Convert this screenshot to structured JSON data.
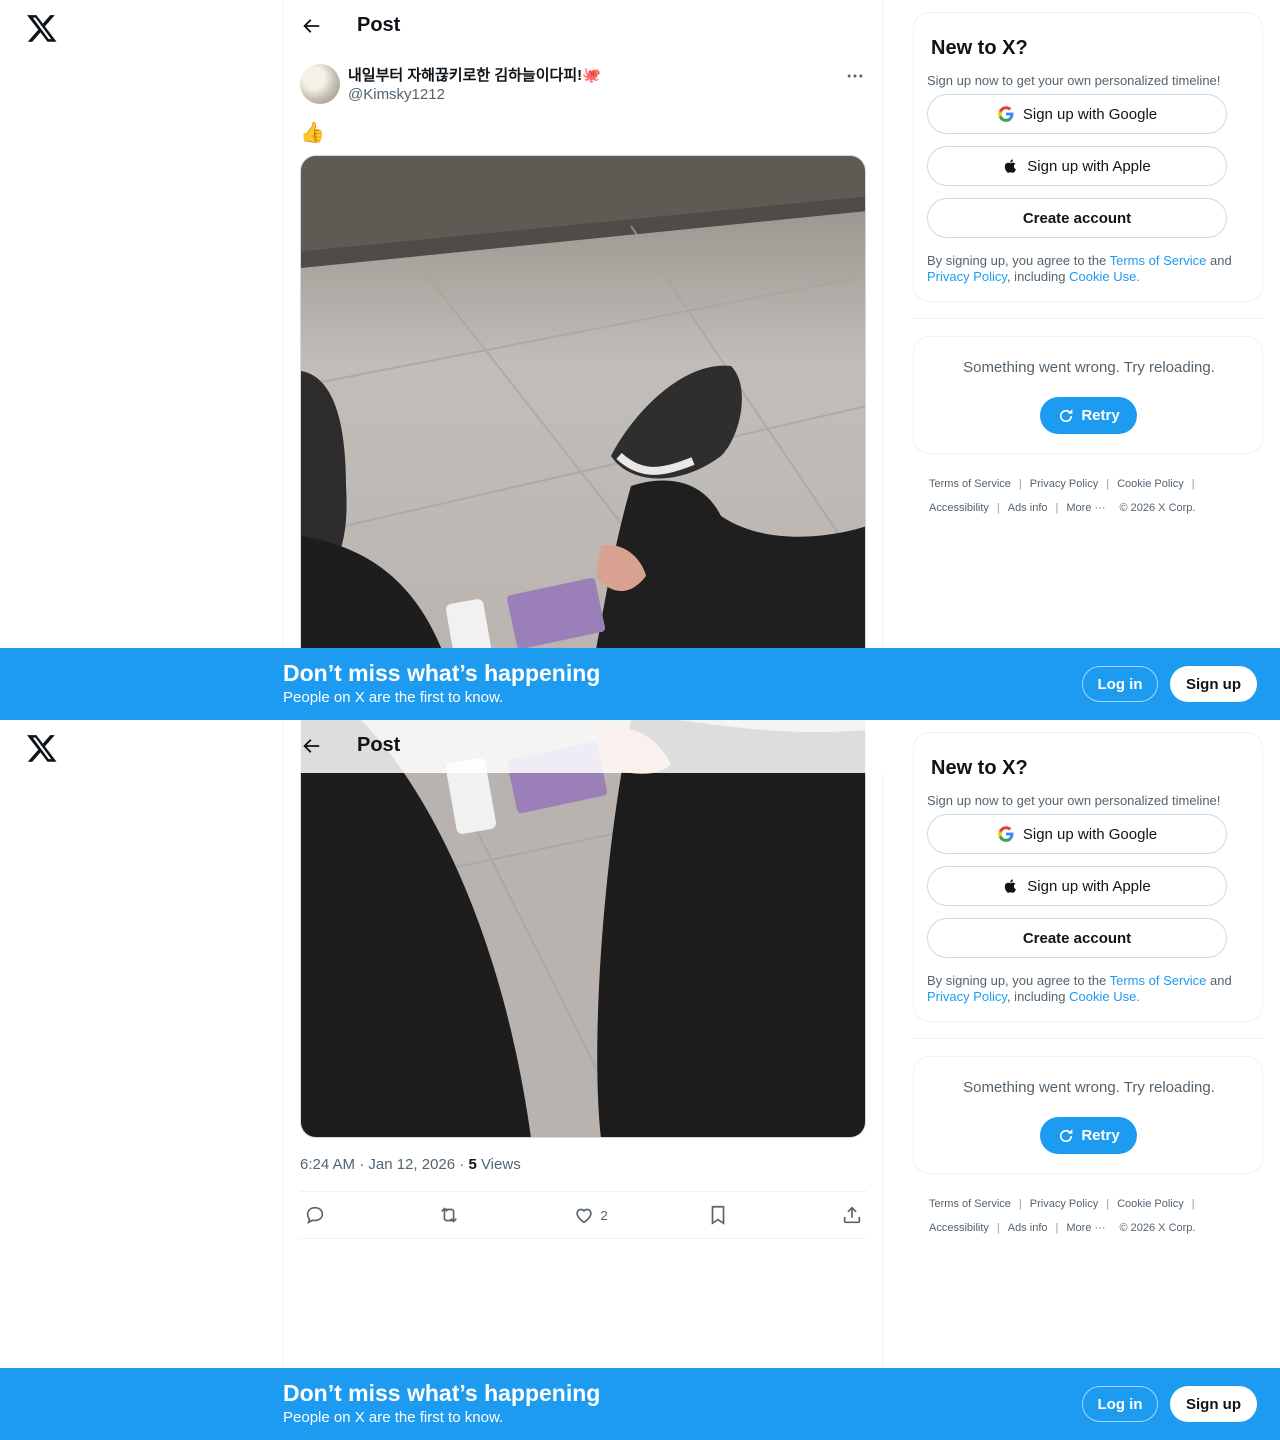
{
  "header": {
    "title": "Post"
  },
  "post": {
    "display_name": "내일부터 자해끊키로한 김하늘이다피!🐙",
    "handle": "@Kimsky1212",
    "text": "👍",
    "time": "6:24 AM · Jan 12, 2026 · ",
    "views_count": "5",
    "views_label": " Views",
    "likes": "2"
  },
  "signup": {
    "title": "New to X?",
    "subtitle": "Sign up now to get your own personalized timeline!",
    "google": "Sign up with Google",
    "apple": "Sign up with Apple",
    "create": "Create account",
    "terms_prefix": "By signing up, you agree to the ",
    "terms_link": "Terms of Service",
    "terms_and": " and",
    "privacy_link": "Privacy Policy",
    "including": ", including ",
    "cookie_link": "Cookie Use."
  },
  "error": {
    "text": "Something went wrong. Try reloading.",
    "retry": "Retry"
  },
  "footer": {
    "terms": "Terms of Service",
    "privacy": "Privacy Policy",
    "cookie": "Cookie Policy",
    "accessibility": "Accessibility",
    "ads": "Ads info",
    "more": "More ···",
    "copyright": "© 2026 X Corp."
  },
  "banner": {
    "title": "Don’t miss what’s happening",
    "subtitle": "People on X are the first to know.",
    "login": "Log in",
    "signup": "Sign up"
  },
  "colors": {
    "accent": "#1d9bf0",
    "text": "#0f1419",
    "muted": "#536471"
  }
}
